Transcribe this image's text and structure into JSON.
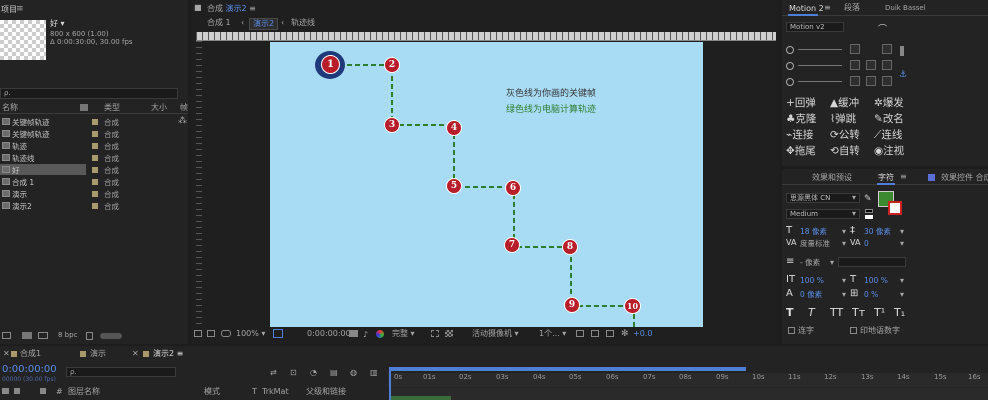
{
  "project": {
    "header": "项目",
    "item_name": "好",
    "item_dims": "800 x 600 (1.00)",
    "item_duration": "Δ 0:00:30:00, 30.00 fps",
    "search_placeholder": "ρ.",
    "col_name": "名称",
    "col_type": "类型",
    "col_size": "大小",
    "col_extra": "帧",
    "bpc": "8 bpc",
    "items": [
      {
        "name": "关键帧轨迹",
        "type": "合成"
      },
      {
        "name": "关键帧轨迹",
        "type": "合成"
      },
      {
        "name": "轨迹",
        "type": "合成"
      },
      {
        "name": "轨迹线",
        "type": "合成"
      },
      {
        "name": "好",
        "type": "合成"
      },
      {
        "name": "合成 1",
        "type": "合成"
      },
      {
        "name": "演示",
        "type": "合成"
      },
      {
        "name": "演示2",
        "type": "合成"
      }
    ]
  },
  "comp": {
    "tab_title": "合成",
    "tab_name": "演示2",
    "breadcrumbs": [
      "合成 1",
      "演示2",
      "轨迹线"
    ],
    "annotation_gray": "灰色线为你画的关键帧",
    "annotation_green": "绿色线为电脑计算轨迹",
    "keyframes": [
      "1",
      "2",
      "3",
      "4",
      "5",
      "6",
      "7",
      "8",
      "9",
      "10"
    ],
    "zoom": "100%",
    "timecode": "0:00:00:00",
    "quality": "完整",
    "camera": "活动摄像机",
    "views": "1个...",
    "exposure": "+0.0"
  },
  "motion": {
    "tab1": "Motion 2",
    "tab2": "段落",
    "tab3": "Duik Bassel",
    "version": "Motion v2",
    "buttons": [
      {
        "icon": "+",
        "label": "回弹"
      },
      {
        "icon": "▲",
        "label": "缓冲"
      },
      {
        "icon": "✲",
        "label": "爆发"
      },
      {
        "icon": "♣",
        "label": "克隆"
      },
      {
        "icon": "⌇",
        "label": "弹跳"
      },
      {
        "icon": "✎",
        "label": "改名"
      },
      {
        "icon": "⌁",
        "label": "连接"
      },
      {
        "icon": "⟳",
        "label": "公转"
      },
      {
        "icon": "⟋",
        "label": "连线"
      },
      {
        "icon": "✥",
        "label": "拖尾"
      },
      {
        "icon": "⟲",
        "label": "自转"
      },
      {
        "icon": "◉",
        "label": "注视"
      }
    ]
  },
  "character": {
    "tab_effects": "效果和预设",
    "tab_char": "字符",
    "tab_controls": "效果控件 合成",
    "font": "思源黑体 CN",
    "weight": "Medium",
    "size": "18 像素",
    "leading": "30 像素",
    "kerning": "度量标准",
    "tracking": "0",
    "stroke": "- 像素",
    "vscale": "100 %",
    "hscale": "100 %",
    "baseline": "0 像素",
    "tsume": "0 %",
    "styles": [
      "T",
      "T",
      "TT",
      "Tт",
      "T¹",
      "T₁"
    ],
    "ligatures": "连字",
    "hindi": "印地语数字",
    "fill_color": "#3c8a2f"
  },
  "timeline": {
    "tabs": [
      "合成1",
      "演示",
      "演示2"
    ],
    "timecode": "0:00:00:00",
    "fps": "00000 (30.00 fps)",
    "search_placeholder": "ρ.",
    "col_layer": "图层名称",
    "col_mode": "模式",
    "col_t": "T",
    "col_trkmat": "TrkMat",
    "col_parent": "父级和链接",
    "ticks": [
      "0s",
      "01s",
      "02s",
      "03s",
      "04s",
      "05s",
      "06s",
      "07s",
      "08s",
      "09s",
      "10s",
      "11s",
      "12s",
      "13s",
      "14s",
      "15s",
      "16s"
    ]
  }
}
